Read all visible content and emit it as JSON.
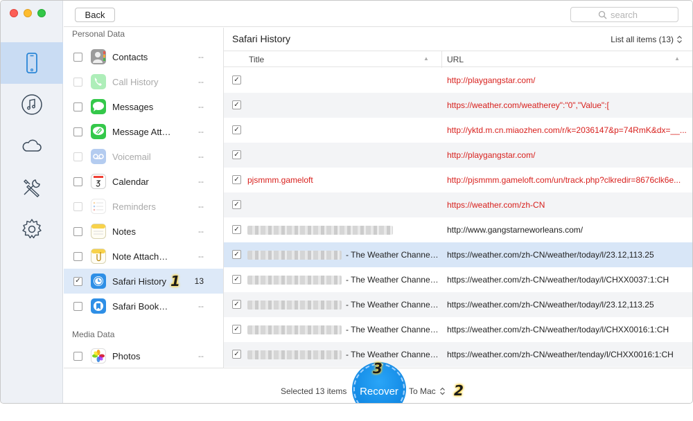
{
  "toolbar": {
    "back_label": "Back",
    "search_placeholder": "search"
  },
  "sections": {
    "personal": "Personal Data",
    "media": "Media Data"
  },
  "categories": [
    {
      "label": "Contacts",
      "count": "--"
    },
    {
      "label": "Call History",
      "count": "--"
    },
    {
      "label": "Messages",
      "count": "--"
    },
    {
      "label": "Message Att…",
      "count": "--"
    },
    {
      "label": "Voicemail",
      "count": "--"
    },
    {
      "label": "Calendar",
      "count": "--"
    },
    {
      "label": "Reminders",
      "count": "--"
    },
    {
      "label": "Notes",
      "count": "--"
    },
    {
      "label": "Note Attach…",
      "count": "--"
    },
    {
      "label": "Safari History",
      "count": "13"
    },
    {
      "label": "Safari Book…",
      "count": "--"
    },
    {
      "label": "Photos",
      "count": "--"
    }
  ],
  "annotations": {
    "one": "1",
    "two": "2",
    "three": "3"
  },
  "main": {
    "title": "Safari History",
    "list_all": "List all items (13)",
    "col_title": "Title",
    "col_url": "URL"
  },
  "rows": [
    {
      "title": "",
      "url": "http://playgangstar.com/"
    },
    {
      "title": "",
      "url": "https://weather.com/weatherey\":\"0\",\"Value\":["
    },
    {
      "title": "",
      "url": "http://yktd.m.cn.miaozhen.com/r/k=2036147&p=74RmK&dx=__..."
    },
    {
      "title": "",
      "url": "http://playgangstar.com/"
    },
    {
      "title": "pjsmmm.gameloft",
      "url": "http://pjsmmm.gameloft.com/un/track.php?clkredir=8676clk6e..."
    },
    {
      "title": "",
      "url": "https://weather.com/zh-CN"
    },
    {
      "title": "",
      "url": "http://www.gangstarneworleans.com/"
    },
    {
      "title": "- The Weather Channel…",
      "url": "https://weather.com/zh-CN/weather/today/l/23.12,113.25"
    },
    {
      "title": "- The Weather Channel…",
      "url": "https://weather.com/zh-CN/weather/today/l/CHXX0037:1:CH"
    },
    {
      "title": "- The Weather Channel…",
      "url": "https://weather.com/zh-CN/weather/today/l/23.12,113.25"
    },
    {
      "title": "- The Weather Channel…",
      "url": "https://weather.com/zh-CN/weather/today/l/CHXX0016:1:CH"
    },
    {
      "title": "- The Weather Channel…",
      "url": "https://weather.com/zh-CN/weather/tenday/l/CHXX0016:1:CH"
    }
  ],
  "bottom": {
    "selected": "Selected 13 items",
    "recover": "Recover",
    "to_mac": "To Mac"
  },
  "colors": {
    "accent": "#168ee8",
    "deleted_red": "#d8201d",
    "selected_row": "#dde9f8",
    "rail_active": "#c9dcf3"
  }
}
